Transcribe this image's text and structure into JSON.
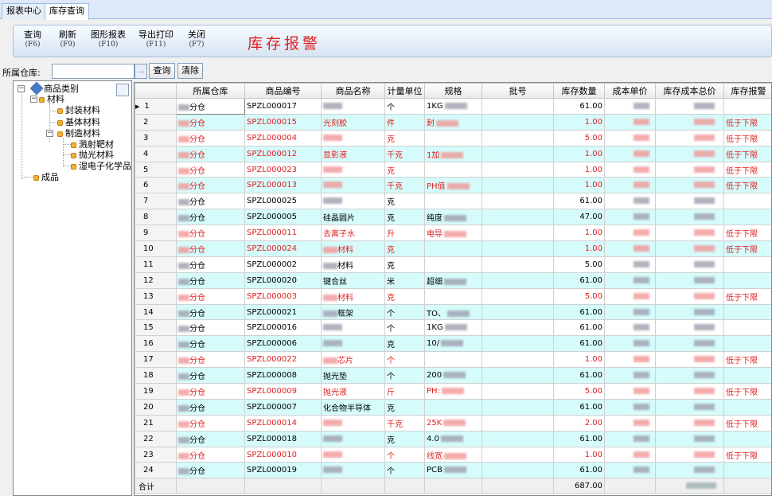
{
  "tabs": [
    {
      "label": "报表中心"
    },
    {
      "label": "库存查询"
    }
  ],
  "toolbar": {
    "buttons": [
      {
        "label": "查询",
        "key": "(F6)"
      },
      {
        "label": "刷新",
        "key": "(F9)"
      },
      {
        "label": "图形报表",
        "key": "(F10)"
      },
      {
        "label": "导出打印",
        "key": "(F11)"
      },
      {
        "label": "关闭",
        "key": "(F7)"
      }
    ],
    "title": "库存报警"
  },
  "filter": {
    "label": "所属仓库:",
    "value": "",
    "browse": "...",
    "query": "查询",
    "clear": "清除"
  },
  "tree": {
    "root": "商品类别",
    "material": "材料",
    "packaging": "封装材料",
    "substrate": "基体材料",
    "process": "制造材料",
    "sputter": "溅射靶材",
    "polish": "抛光材料",
    "wet": "湿电子化学品",
    "product": "成品"
  },
  "table": {
    "columns": [
      "所属仓库",
      "商品编号",
      "商品名称",
      "计量单位",
      "规格",
      "批号",
      "库存数量",
      "成本单价",
      "库存成本总价",
      "库存报警"
    ],
    "rows": [
      {
        "idx": "1",
        "wh": "分仓",
        "code": "SPZL000017",
        "name": "",
        "unit": "个",
        "spec": "1KG",
        "qty": "61.00",
        "alarm": "",
        "warn": false
      },
      {
        "idx": "2",
        "wh": "分仓",
        "code": "SPZL000015",
        "name": "光刻胶",
        "unit": "件",
        "spec": "耐",
        "qty": "1.00",
        "alarm": "低于下限",
        "warn": true
      },
      {
        "idx": "3",
        "wh": "分仓",
        "code": "SPZL000004",
        "name": "",
        "unit": "克",
        "spec": "",
        "qty": "5.00",
        "alarm": "低于下限",
        "warn": true
      },
      {
        "idx": "4",
        "wh": "分仓",
        "code": "SPZL000012",
        "name": "显影液",
        "unit": "千克",
        "spec": "1加",
        "qty": "1.00",
        "alarm": "低于下限",
        "warn": true
      },
      {
        "idx": "5",
        "wh": "分仓",
        "code": "SPZL000023",
        "name": "",
        "unit": "克",
        "spec": "",
        "qty": "1.00",
        "alarm": "低于下限",
        "warn": true
      },
      {
        "idx": "6",
        "wh": "分仓",
        "code": "SPZL000013",
        "name": "",
        "unit": "千克",
        "spec": "PH值",
        "qty": "1.00",
        "alarm": "低于下限",
        "warn": true
      },
      {
        "idx": "7",
        "wh": "分仓",
        "code": "SPZL000025",
        "name": "",
        "unit": "克",
        "spec": "",
        "qty": "61.00",
        "alarm": "",
        "warn": false
      },
      {
        "idx": "8",
        "wh": "分仓",
        "code": "SPZL000005",
        "name": "硅晶圆片",
        "unit": "克",
        "spec": "纯度",
        "qty": "47.00",
        "alarm": "",
        "warn": false
      },
      {
        "idx": "9",
        "wh": "分仓",
        "code": "SPZL000011",
        "name": "去离子水",
        "unit": "升",
        "spec": "电导",
        "qty": "1.00",
        "alarm": "低于下限",
        "warn": true
      },
      {
        "idx": "10",
        "wh": "分仓",
        "code": "SPZL000024",
        "name": "材料",
        "unit": "克",
        "spec": "",
        "qty": "1.00",
        "alarm": "低于下限",
        "warn": true
      },
      {
        "idx": "11",
        "wh": "分仓",
        "code": "SPZL000002",
        "name": "材料",
        "unit": "克",
        "spec": "",
        "qty": "5.00",
        "alarm": "",
        "warn": false
      },
      {
        "idx": "12",
        "wh": "分仓",
        "code": "SPZL000020",
        "name": "键合丝",
        "unit": "米",
        "spec": "超细",
        "qty": "61.00",
        "alarm": "",
        "warn": false
      },
      {
        "idx": "13",
        "wh": "分仓",
        "code": "SPZL000003",
        "name": "材料",
        "unit": "克",
        "spec": "",
        "qty": "5.00",
        "alarm": "低于下限",
        "warn": true
      },
      {
        "idx": "14",
        "wh": "分仓",
        "code": "SPZL000021",
        "name": "框架",
        "unit": "个",
        "spec": "TO、",
        "qty": "61.00",
        "alarm": "",
        "warn": false
      },
      {
        "idx": "15",
        "wh": "分仓",
        "code": "SPZL000016",
        "name": "",
        "unit": "个",
        "spec": "1KG",
        "qty": "61.00",
        "alarm": "",
        "warn": false
      },
      {
        "idx": "16",
        "wh": "分仓",
        "code": "SPZL000006",
        "name": "",
        "unit": "克",
        "spec": "10/",
        "qty": "61.00",
        "alarm": "",
        "warn": false
      },
      {
        "idx": "17",
        "wh": "分仓",
        "code": "SPZL000022",
        "name": "芯片",
        "unit": "个",
        "spec": "",
        "qty": "1.00",
        "alarm": "低于下限",
        "warn": true
      },
      {
        "idx": "18",
        "wh": "分仓",
        "code": "SPZL000008",
        "name": "抛光垫",
        "unit": "个",
        "spec": "200",
        "qty": "61.00",
        "alarm": "",
        "warn": false
      },
      {
        "idx": "19",
        "wh": "分仓",
        "code": "SPZL000009",
        "name": "抛光液",
        "unit": "斤",
        "spec": "PH:",
        "qty": "5.00",
        "alarm": "低于下限",
        "warn": true
      },
      {
        "idx": "20",
        "wh": "分仓",
        "code": "SPZL000007",
        "name": "化合物半导体",
        "unit": "克",
        "spec": "",
        "qty": "61.00",
        "alarm": "",
        "warn": false
      },
      {
        "idx": "21",
        "wh": "分仓",
        "code": "SPZL000014",
        "name": "",
        "unit": "千克",
        "spec": "25K",
        "qty": "2.00",
        "alarm": "低于下限",
        "warn": true
      },
      {
        "idx": "22",
        "wh": "分仓",
        "code": "SPZL000018",
        "name": "",
        "unit": "克",
        "spec": "4.0",
        "qty": "61.00",
        "alarm": "",
        "warn": false
      },
      {
        "idx": "23",
        "wh": "分仓",
        "code": "SPZL000010",
        "name": "",
        "unit": "个",
        "spec": "线宽",
        "qty": "1.00",
        "alarm": "低于下限",
        "warn": true
      },
      {
        "idx": "24",
        "wh": "分仓",
        "code": "SPZL000019",
        "name": "",
        "unit": "个",
        "spec": "PCB",
        "qty": "61.00",
        "alarm": "",
        "warn": false
      }
    ],
    "total": {
      "label": "合计",
      "qty": "687.00"
    }
  }
}
